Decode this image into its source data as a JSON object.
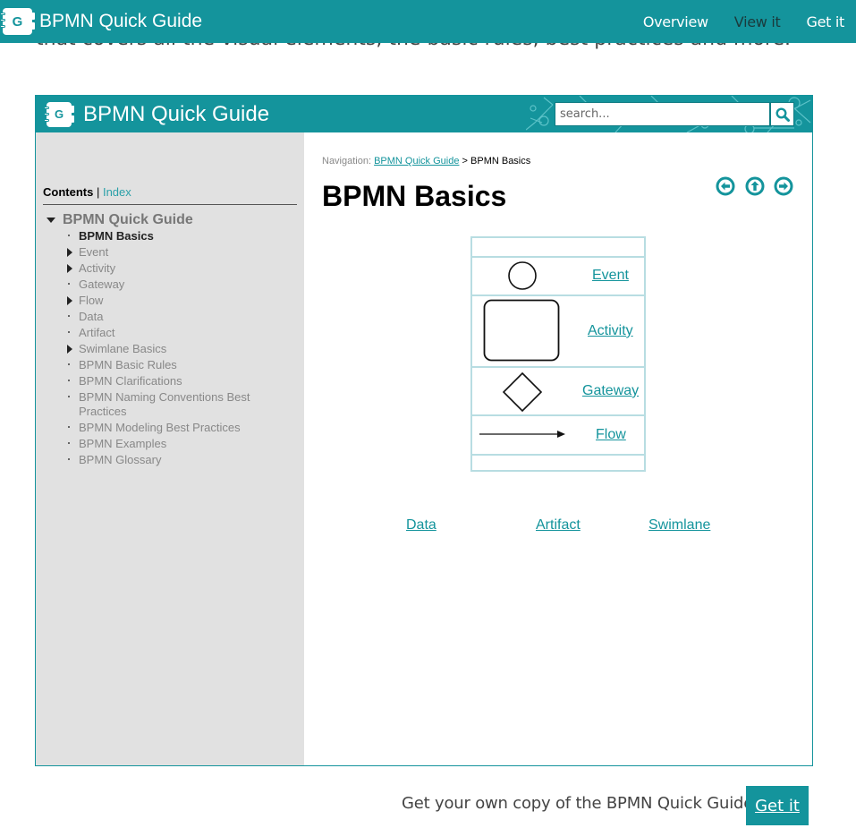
{
  "site": {
    "title": "BPMN Quick Guide",
    "logo_letter": "G",
    "nav": [
      {
        "label": "Overview",
        "active": false
      },
      {
        "label": "View it",
        "active": true
      },
      {
        "label": "Get it",
        "active": false
      }
    ],
    "partial_text": "that covers all the visual elements, the basic rules, best practices and more."
  },
  "guide": {
    "title": "BPMN Quick Guide",
    "logo_letter": "G",
    "search": {
      "placeholder": "search...",
      "value": "",
      "icon": "search-icon"
    },
    "sidebar": {
      "tab_contents": "Contents",
      "tab_separator": " | ",
      "tab_index": "Index",
      "root": "BPMN Quick Guide",
      "items": [
        {
          "label": "BPMN Basics",
          "marker": "dot",
          "current": true
        },
        {
          "label": "Event",
          "marker": "arrow",
          "current": false
        },
        {
          "label": "Activity",
          "marker": "arrow",
          "current": false
        },
        {
          "label": "Gateway",
          "marker": "dot",
          "current": false
        },
        {
          "label": "Flow",
          "marker": "arrow",
          "current": false
        },
        {
          "label": "Data",
          "marker": "dot",
          "current": false
        },
        {
          "label": "Artifact",
          "marker": "dot",
          "current": false
        },
        {
          "label": "Swimlane Basics",
          "marker": "arrow",
          "current": false
        },
        {
          "label": "BPMN Basic Rules",
          "marker": "dot",
          "current": false
        },
        {
          "label": "BPMN Clarifications",
          "marker": "dot",
          "current": false
        },
        {
          "label": "BPMN Naming Conventions Best Practices",
          "marker": "dot",
          "current": false
        },
        {
          "label": "BPMN Modeling Best Practices",
          "marker": "dot",
          "current": false
        },
        {
          "label": "BPMN Examples",
          "marker": "dot",
          "current": false
        },
        {
          "label": "BPMN Glossary",
          "marker": "dot",
          "current": false
        }
      ]
    },
    "content": {
      "breadcrumb_prefix": "Navigation: ",
      "breadcrumb_link": "BPMN Quick Guide",
      "breadcrumb_sep": " > ",
      "breadcrumb_current": "BPMN Basics",
      "title": "BPMN Basics",
      "nav_icons": [
        "previous-icon",
        "up-icon",
        "next-icon"
      ],
      "diagram_links": [
        "Event",
        "Activity",
        "Gateway",
        "Flow"
      ],
      "bottom_links": [
        "Data",
        "Artifact",
        "Swimlane"
      ]
    }
  },
  "cta": {
    "text": "Get your own copy of the BPMN Quick Guide",
    "button": "Get it"
  },
  "colors": {
    "brand": "#14949c",
    "sidebar_bg": "#e1e1e1",
    "diagram_border": "#b8dde2"
  }
}
